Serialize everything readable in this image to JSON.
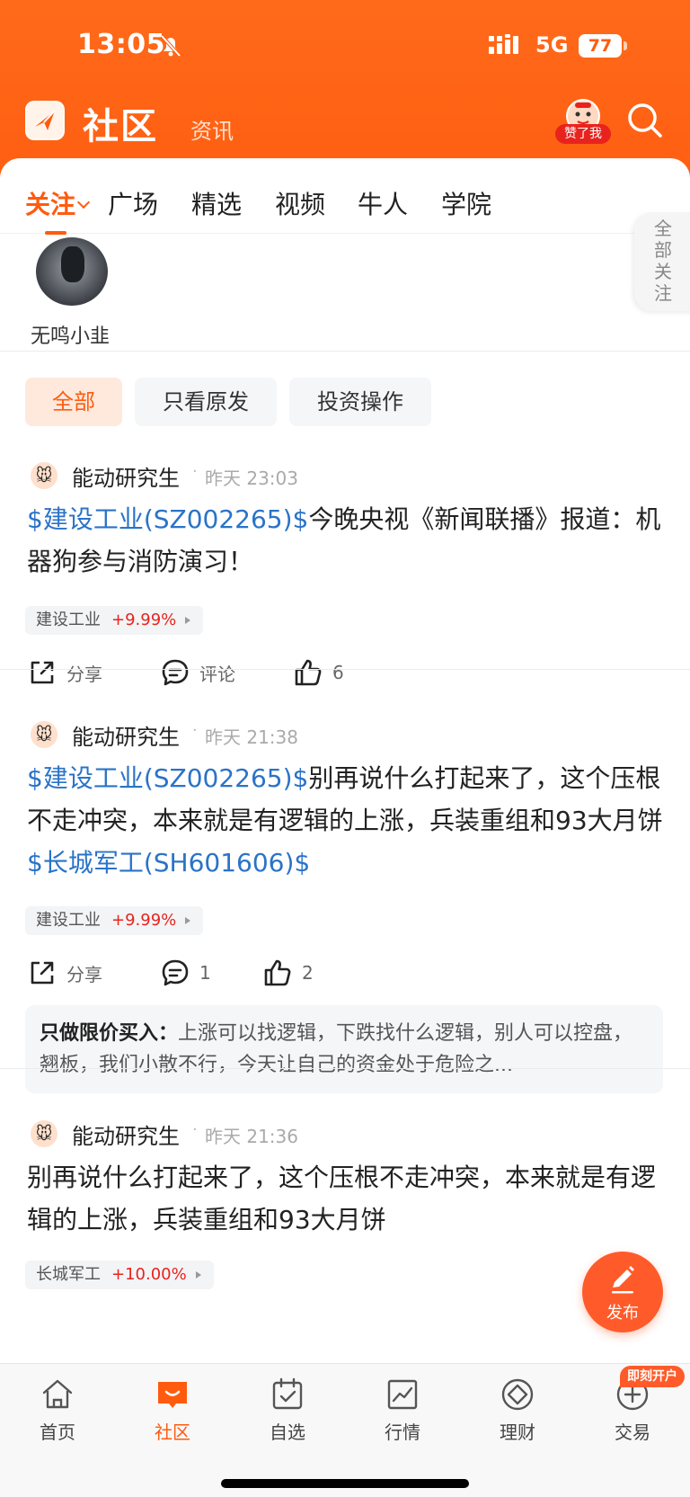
{
  "status_bar": {
    "time": "13:05",
    "network": "5G",
    "battery": "77"
  },
  "header": {
    "title": "社区",
    "subtitle": "资讯",
    "like_badge": "赞了我"
  },
  "tabs": [
    {
      "label": "关注",
      "active": true
    },
    {
      "label": "广场",
      "active": false
    },
    {
      "label": "精选",
      "active": false
    },
    {
      "label": "视频",
      "active": false
    },
    {
      "label": "牛人",
      "active": false
    },
    {
      "label": "学院",
      "active": false
    }
  ],
  "following": {
    "name": "无鸣小韭",
    "all_follow_label": "全部关注"
  },
  "filters": [
    {
      "label": "全部",
      "active": true
    },
    {
      "label": "只看原发",
      "active": false
    },
    {
      "label": "投资操作",
      "active": false
    }
  ],
  "posts": [
    {
      "author": "能动研究生",
      "time": "昨天 23:03",
      "stock_ref": "$建设工业(SZ002265)$",
      "text": "今晚央视《新闻联播》报道：机器狗参与消防演习！",
      "tag": {
        "name": "建设工业",
        "change": "+9.99%"
      },
      "share_label": "分享",
      "comment_label": "评论",
      "likes": "6"
    },
    {
      "author": "能动研究生",
      "time": "昨天 21:38",
      "stock_ref": "$建设工业(SZ002265)$",
      "text": "别再说什么打起来了，这个压根不走冲突，本来就是有逻辑的上涨，兵装重组和93大月饼",
      "stock_ref2": "$长城军工(SH601606)$",
      "tag": {
        "name": "建设工业",
        "change": "+9.99%"
      },
      "share_label": "分享",
      "comment_label": "1",
      "likes": "2",
      "reply": {
        "author": "只做限价买入：",
        "text": "上涨可以找逻辑，下跌找什么逻辑，别人可以控盘，翘板，我们小散不行，今天让自己的资金处于危险之..."
      }
    },
    {
      "author": "能动研究生",
      "time": "昨天 21:36",
      "text": "别再说什么打起来了，这个压根不走冲突，本来就是有逻辑的上涨，兵装重组和93大月饼",
      "tag": {
        "name": "长城军工",
        "change": "+10.00%"
      }
    }
  ],
  "fab": {
    "label": "发布"
  },
  "bottom_nav": [
    {
      "label": "首页",
      "icon": "home-icon"
    },
    {
      "label": "社区",
      "icon": "community-icon",
      "active": true
    },
    {
      "label": "自选",
      "icon": "watchlist-icon"
    },
    {
      "label": "行情",
      "icon": "market-icon"
    },
    {
      "label": "理财",
      "icon": "wealth-icon"
    },
    {
      "label": "交易",
      "icon": "trade-icon",
      "badge": "即刻开户"
    }
  ],
  "colors": {
    "brand": "#ff5b0f",
    "link": "#2a73c8",
    "up": "#e8231e"
  }
}
